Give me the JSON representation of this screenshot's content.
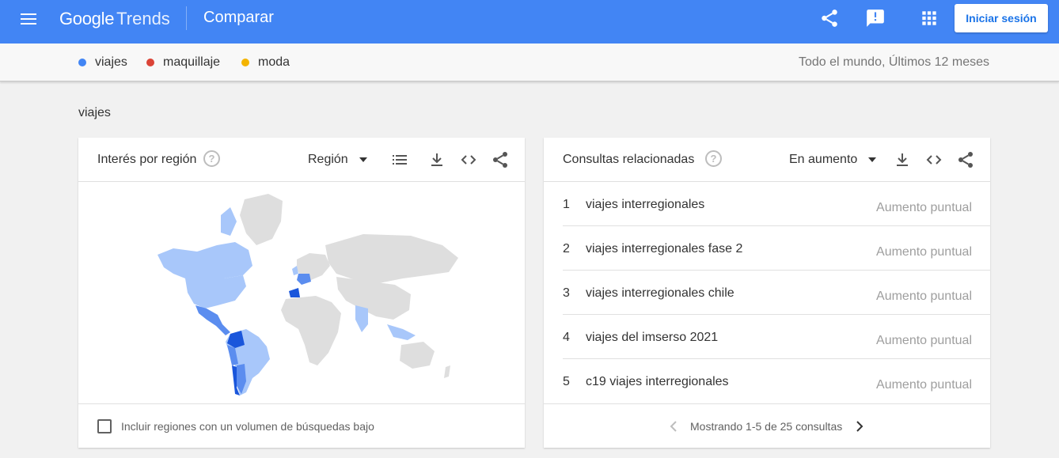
{
  "header": {
    "logo_google": "Google",
    "logo_trends": "Trends",
    "page_title": "Comparar",
    "signin_label": "Iniciar sesión",
    "icons": [
      "menu-icon",
      "share-icon",
      "feedback-icon",
      "apps-icon"
    ]
  },
  "terms": [
    {
      "label": "viajes",
      "color": "#4285f4"
    },
    {
      "label": "maquillaje",
      "color": "#db4437"
    },
    {
      "label": "moda",
      "color": "#f4b400"
    }
  ],
  "scope": "Todo el mundo, Últimos 12 meses",
  "section_label": "viajes",
  "region_card": {
    "title": "Interés por región",
    "dropdown": "Región",
    "checkbox_label": "Incluir regiones con un volumen de búsquedas bajo",
    "icons": [
      "help-icon",
      "list-icon",
      "download-icon",
      "embed-icon",
      "share-icon"
    ],
    "map_colors": {
      "none": "#dedede",
      "low": "#a8c7fa",
      "mid": "#5b8def",
      "high": "#1a56db"
    }
  },
  "queries_card": {
    "title": "Consultas relacionadas",
    "dropdown": "En aumento",
    "icons": [
      "help-icon",
      "download-icon",
      "embed-icon",
      "share-icon"
    ],
    "rows": [
      {
        "rank": "1",
        "query": "viajes interregionales",
        "value": "Aumento puntual"
      },
      {
        "rank": "2",
        "query": "viajes interregionales fase 2",
        "value": "Aumento puntual"
      },
      {
        "rank": "3",
        "query": "viajes interregionales chile",
        "value": "Aumento puntual"
      },
      {
        "rank": "4",
        "query": "viajes del imserso 2021",
        "value": "Aumento puntual"
      },
      {
        "rank": "5",
        "query": "c19 viajes interregionales",
        "value": "Aumento puntual"
      }
    ],
    "pager_text": "Mostrando 1-5 de 25 consultas"
  }
}
